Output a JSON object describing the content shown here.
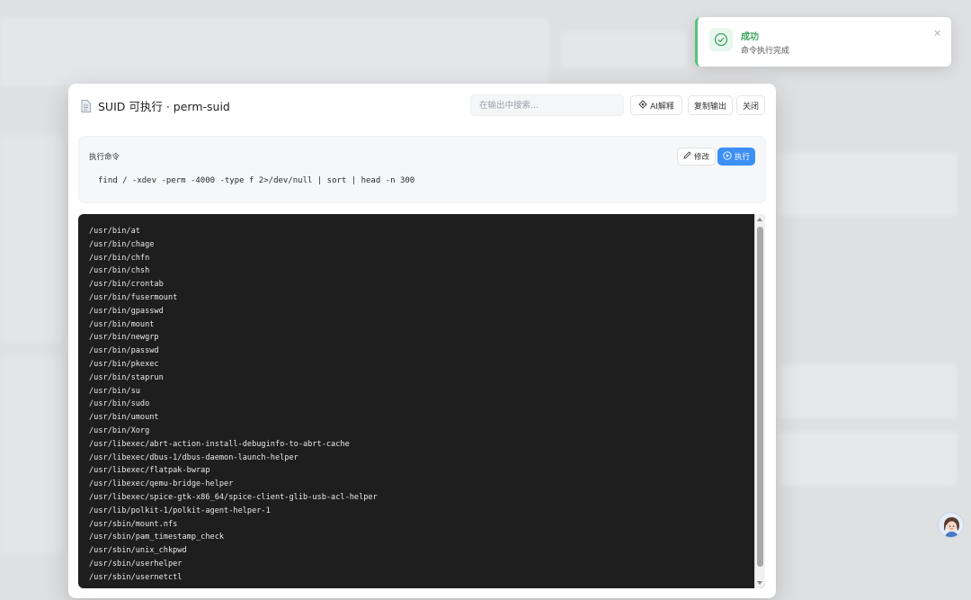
{
  "modal": {
    "title": "SUID 可执行 · perm-suid",
    "search_placeholder": "在输出中搜索...",
    "ai_button": "AI解释",
    "copy_button": "复制输出",
    "close_button": "关闭"
  },
  "command": {
    "label": "执行命令",
    "edit_button": "修改",
    "run_button": "执行",
    "text": "find / -xdev -perm -4000 -type f 2>/dev/null | sort | head -n 300"
  },
  "output": {
    "lines": [
      "/usr/bin/at",
      "/usr/bin/chage",
      "/usr/bin/chfn",
      "/usr/bin/chsh",
      "/usr/bin/crontab",
      "/usr/bin/fusermount",
      "/usr/bin/gpasswd",
      "/usr/bin/mount",
      "/usr/bin/newgrp",
      "/usr/bin/passwd",
      "/usr/bin/pkexec",
      "/usr/bin/staprun",
      "/usr/bin/su",
      "/usr/bin/sudo",
      "/usr/bin/umount",
      "/usr/bin/Xorg",
      "/usr/libexec/abrt-action-install-debuginfo-to-abrt-cache",
      "/usr/libexec/dbus-1/dbus-daemon-launch-helper",
      "/usr/libexec/flatpak-bwrap",
      "/usr/libexec/qemu-bridge-helper",
      "/usr/libexec/spice-gtk-x86_64/spice-client-glib-usb-acl-helper",
      "/usr/lib/polkit-1/polkit-agent-helper-1",
      "/usr/sbin/mount.nfs",
      "/usr/sbin/pam_timestamp_check",
      "/usr/sbin/unix_chkpwd",
      "/usr/sbin/userhelper",
      "/usr/sbin/usernetctl"
    ]
  },
  "toast": {
    "title": "成功",
    "message": "命令执行完成",
    "close_glyph": "×"
  },
  "icons": {
    "document": "document-icon",
    "ai": "ai-icon",
    "edit": "pencil-icon",
    "run": "play-icon",
    "success": "check-circle-icon",
    "close": "close-icon",
    "avatar": "assistant-avatar"
  },
  "colors": {
    "accent": "#3b8ff5",
    "success": "#3ba55d",
    "terminal_bg": "#1e1e1e"
  }
}
